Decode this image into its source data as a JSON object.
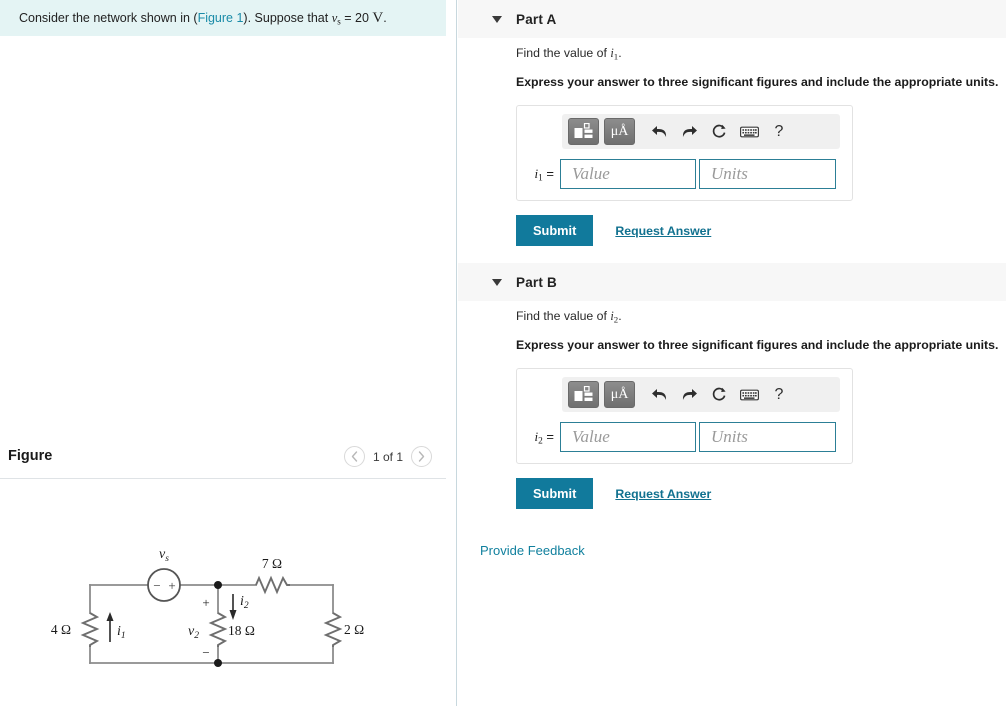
{
  "problem": {
    "text_before_link": "Consider the network shown in (",
    "link_label": "Figure 1",
    "text_after_link": "). Suppose that ",
    "var_symbol": "v",
    "var_sub": "s",
    "equals_value": " = 20 ",
    "unit": "V",
    "period": "."
  },
  "figure": {
    "title": "Figure",
    "pager_label": "1 of 1",
    "prev_icon": "chevron-left-icon",
    "next_icon": "chevron-right-icon",
    "circuit": {
      "source_label": "v",
      "source_sub": "s",
      "source_minus": "−",
      "source_plus": "+",
      "r_left": "4 Ω",
      "r_mid": "18 Ω",
      "r_top": "7 Ω",
      "r_right": "2 Ω",
      "i1_label": "i",
      "i1_sub": "1",
      "i2_label": "i",
      "i2_sub": "2",
      "v2_label": "v",
      "v2_sub": "2",
      "polarity_plus": "+",
      "polarity_minus": "−"
    }
  },
  "parts": [
    {
      "id": "a",
      "header": "Part A",
      "caret_icon": "caret-down-icon",
      "question_prefix": "Find the value of ",
      "question_var": "i",
      "question_sub": "1",
      "question_suffix": ".",
      "instruction": "Express your answer to three significant figures and include the appropriate units.",
      "toolbar": [
        {
          "name": "template-math-icon",
          "label": ""
        },
        {
          "name": "units-micro-angstrom-icon",
          "label": "μÅ"
        },
        {
          "name": "undo-icon",
          "label": ""
        },
        {
          "name": "redo-icon",
          "label": ""
        },
        {
          "name": "reset-icon",
          "label": ""
        },
        {
          "name": "keyboard-icon",
          "label": ""
        },
        {
          "name": "help-icon",
          "label": "?"
        }
      ],
      "answer_var": "i",
      "answer_sub": "1",
      "answer_equals": "=",
      "value_placeholder": "Value",
      "units_placeholder": "Units",
      "value_current": "",
      "units_current": "",
      "submit_label": "Submit",
      "request_label": "Request Answer"
    },
    {
      "id": "b",
      "header": "Part B",
      "caret_icon": "caret-down-icon",
      "question_prefix": "Find the value of ",
      "question_var": "i",
      "question_sub": "2",
      "question_suffix": ".",
      "instruction": "Express your answer to three significant figures and include the appropriate units.",
      "toolbar": [
        {
          "name": "template-math-icon",
          "label": ""
        },
        {
          "name": "units-micro-angstrom-icon",
          "label": "μÅ"
        },
        {
          "name": "undo-icon",
          "label": ""
        },
        {
          "name": "redo-icon",
          "label": ""
        },
        {
          "name": "reset-icon",
          "label": ""
        },
        {
          "name": "keyboard-icon",
          "label": ""
        },
        {
          "name": "help-icon",
          "label": "?"
        }
      ],
      "answer_var": "i",
      "answer_sub": "2",
      "answer_equals": "=",
      "value_placeholder": "Value",
      "units_placeholder": "Units",
      "value_current": "",
      "units_current": "",
      "submit_label": "Submit",
      "request_label": "Request Answer"
    }
  ],
  "footer": {
    "provide_feedback": "Provide Feedback"
  },
  "colors": {
    "statement_bg": "#e4f4f4",
    "link": "#1a8ba8",
    "submit_bg": "#117a9c",
    "part_header_bg": "#f7f7f7",
    "input_border": "#2c7f96"
  }
}
